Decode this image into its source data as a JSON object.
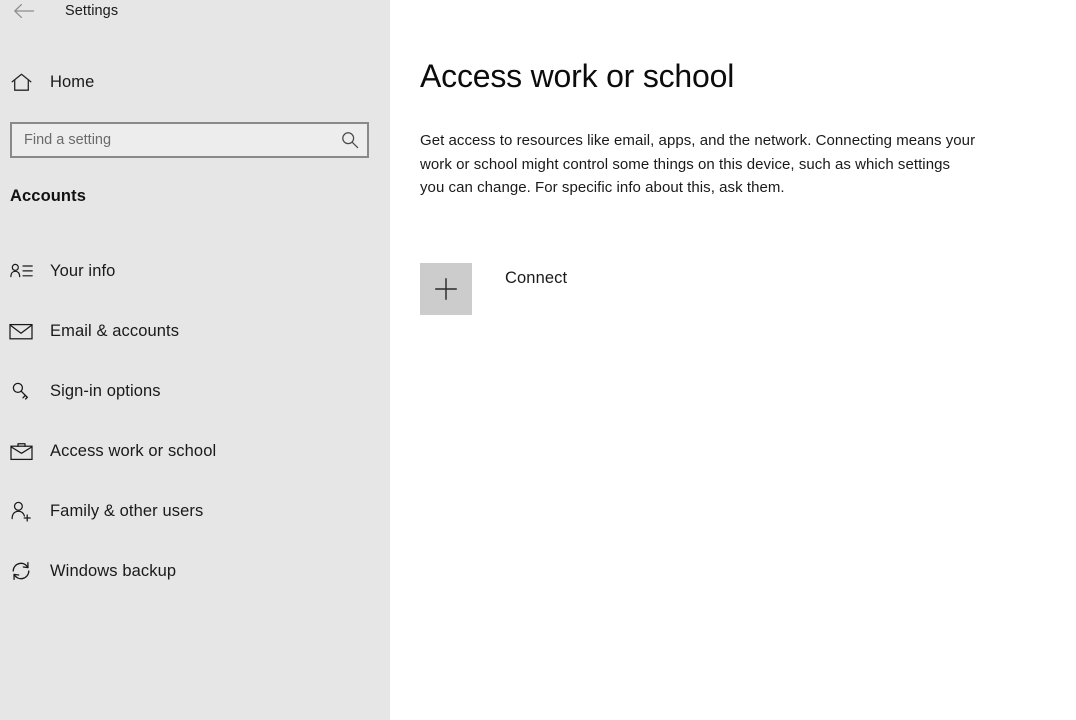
{
  "window": {
    "app_title": "Settings",
    "back_icon": "back-arrow-icon"
  },
  "sidebar": {
    "background_color": "#e6e6e6",
    "home": {
      "label": "Home",
      "icon": "home-icon"
    },
    "search": {
      "placeholder": "Find a setting",
      "value": "",
      "icon": "search-icon"
    },
    "section_heading": "Accounts",
    "items": [
      {
        "label": "Your info",
        "icon": "contact-card-icon",
        "selected": false
      },
      {
        "label": "Email & accounts",
        "icon": "envelope-icon",
        "selected": false
      },
      {
        "label": "Sign-in options",
        "icon": "key-icon",
        "selected": false
      },
      {
        "label": "Access work or school",
        "icon": "briefcase-icon",
        "selected": true
      },
      {
        "label": "Family & other users",
        "icon": "person-add-icon",
        "selected": false
      },
      {
        "label": "Windows backup",
        "icon": "sync-refresh-icon",
        "selected": false
      }
    ]
  },
  "main": {
    "title": "Access work or school",
    "description": "Get access to resources like email, apps, and the network. Connecting means your work or school might control some things on this device, such as which settings you can change. For specific info about this, ask them.",
    "connect": {
      "label": "Connect",
      "icon": "plus-icon",
      "tile_color": "#cccccc"
    }
  }
}
